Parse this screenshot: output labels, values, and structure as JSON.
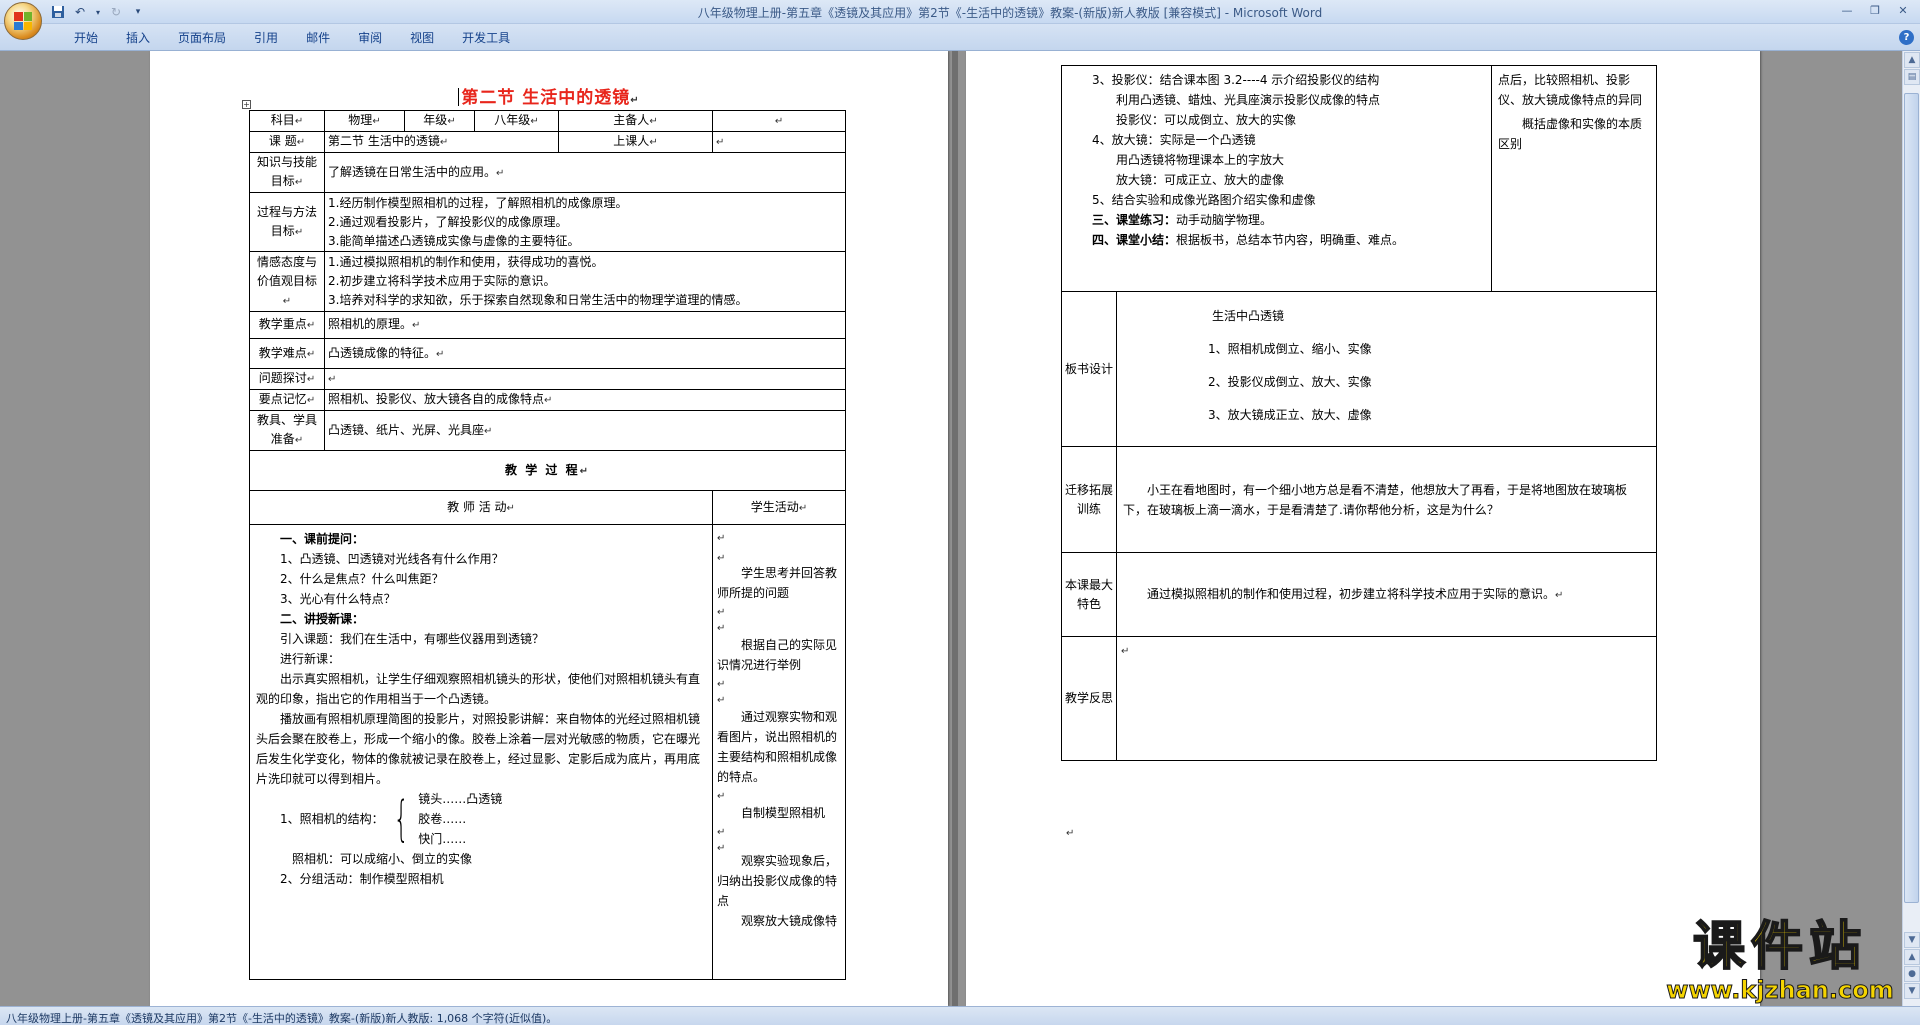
{
  "window": {
    "title": "八年级物理上册-第五章《透镜及其应用》第2节《-生活中的透镜》教案-(新版)新人教版 [兼容模式] - Microsoft Word"
  },
  "ribbon": {
    "tabs": [
      "开始",
      "插入",
      "页面布局",
      "引用",
      "邮件",
      "审阅",
      "视图",
      "开发工具"
    ]
  },
  "document": {
    "title": "第二节  生活中的透镜",
    "info": {
      "subject_label": "科目",
      "subject": "物理",
      "grade_label": "年级",
      "grade": "八年级",
      "lead_label": "主备人",
      "topic_label": "课  题",
      "topic": "第二节 生活中的透镜",
      "teacher_label": "上课人"
    },
    "rows": {
      "knowledge_label": "知识与技能目标",
      "knowledge": "了解透镜在日常生活中的应用。",
      "process_label": "过程与方法目标",
      "process": [
        "1.经历制作模型照相机的过程，了解照相机的成像原理。",
        "2.通过观看投影片，了解投影仪的成像原理。",
        "3.能简单描述凸透镜成实像与虚像的主要特征。"
      ],
      "emotion_label": "情感态度与价值观目标",
      "emotion": [
        "1.通过模拟照相机的制作和使用，获得成功的喜悦。",
        "2.初步建立将科学技术应用于实际的意识。",
        "3.培养对科学的求知欲，乐于探索自然现象和日常生活中的物理学道理的情感。"
      ],
      "key_label": "教学重点",
      "key": "照相机的原理。",
      "difficulty_label": "教学难点",
      "difficulty": "凸透镜成像的特征。",
      "inquiry_label": "问题探讨",
      "memo_label": "要点记忆",
      "memo": "照相机、投影仪、放大镜各自的成像特点",
      "tools_label": "教具、学具准备",
      "tools": "凸透镜、纸片、光屏、光具座"
    },
    "process_header": "教    学    过    程",
    "teacher_col": "教  师  活  动",
    "student_col": "学生活动",
    "teacher_activities": {
      "s1_title": "一、课前提问：",
      "s1_q1": "1、凸透镜、凹透镜对光线各有什么作用？",
      "s1_q2": "2、什么是焦点？什么叫焦距？",
      "s1_q3": "3、光心有什么特点？",
      "s2_title": "二、讲授新课：",
      "intro": "引入课题：我们在生活中，有哪些仪器用到透镜？",
      "new_lesson": "进行新课：",
      "para1": "出示真实照相机，让学生仔细观察照相机镜头的形状，使他们对照相机镜头有直观的印象，指出它的作用相当于一个凸透镜。",
      "para2": "播放画有照相机原理简图的投影片，对照投影讲解：来自物体的光经过照相机镜头后会聚在胶卷上，形成一个缩小的像。胶卷上涂着一层对光敏感的物质，它在曝光后发生化学变化，物体的像就被记录在胶卷上，经过显影、定影后成为底片，再用底片洗印就可以得到相片。",
      "camera_struct": "1、照相机的结构：",
      "struct_items": [
        "镜头……凸透镜",
        "胶卷……",
        "快门……"
      ],
      "camera_image": "照相机：可以成缩小、倒立的实像",
      "group": "2、分组活动：制作模型照相机"
    },
    "student_activities": [
      "学生思考并回答教师所提的问题",
      "根据自己的实际见识情况进行举例",
      "通过观察实物和观看图片，说出照相机的主要结构和照相机成像的特点。",
      "自制模型照相机",
      "观察实验现象后，归纳出投影仪成像的特点",
      "观察放大镜成像特"
    ],
    "page2": {
      "teacher_lines": [
        "3、投影仪：结合课本图 3.2----4 示介绍投影仪的结构",
        "利用凸透镜、蜡烛、光具座演示投影仪成像的特点",
        "投影仪：可以成倒立、放大的实像",
        "4、放大镜：实际是一个凸透镜",
        "用凸透镜将物理课本上的字放大",
        "放大镜：可成正立、放大的虚像",
        "5、结合实验和成像光路图介绍实像和虚像"
      ],
      "practice_title": "三、课堂练习：",
      "practice": "动手动脑学物理。",
      "summary_title": "四、课堂小结：",
      "summary": "根据板书，总结本节内容，明确重、难点。",
      "student_text": "点后，比较照相机、投影仪、放大镜成像特点的异同",
      "student_text2": "概括虚像和实像的本质区别",
      "board_label": "板书设计",
      "board_title": "生活中凸透镜",
      "board_items": [
        "1、照相机成倒立、缩小、实像",
        "2、投影仪成倒立、放大、实像",
        "3、放大镜成正立、放大、虚像"
      ],
      "transfer_label": "迁移拓展训练",
      "transfer": "小王在看地图时，有一个细小地方总是看不清楚，他想放大了再看，于是将地图放在玻璃板下，在玻璃板上滴一滴水，于是看清楚了.请你帮他分析，这是为什么？",
      "feature_label": "本课最大特色",
      "feature": "通过模拟照相机的制作和使用过程，初步建立将科学技术应用于实际的意识。",
      "reflect_label": "教学反思"
    }
  },
  "status_bar": {
    "text": "八年级物理上册-第五章《透镜及其应用》第2节《-生活中的透镜》教案-(新版)新人教版: 1,068 个字符(近似值)。"
  },
  "watermark": {
    "brand": "课件站",
    "url": "www.kjzhan.com"
  }
}
